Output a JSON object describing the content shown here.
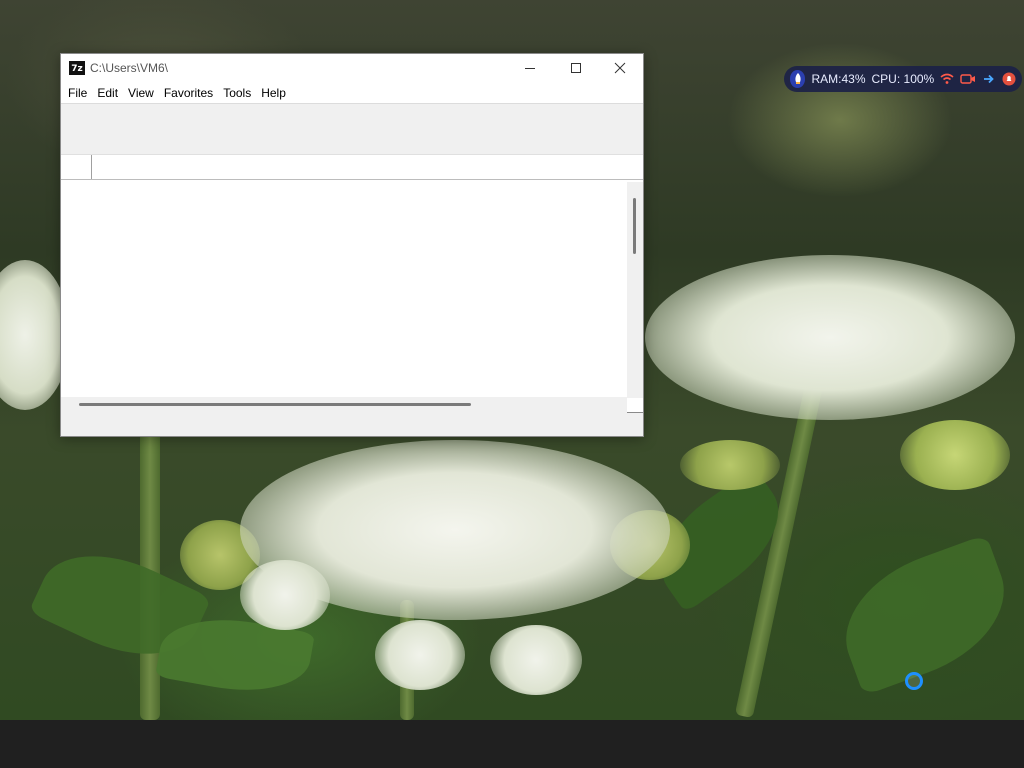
{
  "window": {
    "title": "C:\\Users\\VM6\\",
    "app_icon_text": "7z",
    "menu": [
      "File",
      "Edit",
      "View",
      "Favorites",
      "Tools",
      "Help"
    ],
    "address_value": "",
    "status_text": ""
  },
  "tray": {
    "ram_label": "RAM:",
    "ram_value": "43%",
    "cpu_label": "CPU:",
    "cpu_value": "100%",
    "icons": [
      "rocket-icon",
      "wifi-icon",
      "camera-icon",
      "arrow-right-icon",
      "bell-icon"
    ]
  },
  "colors": {
    "tray_bg": "#1c2246",
    "accent_blue": "#1e90ff",
    "taskbar": "#202020"
  }
}
